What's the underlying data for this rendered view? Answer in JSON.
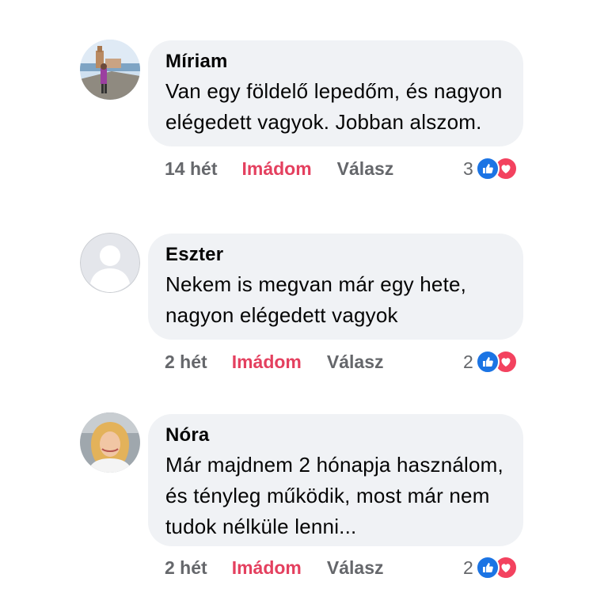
{
  "comments": [
    {
      "author": "Míriam",
      "lines": [
        "Van egy földelő lepedőm, és nagyon",
        "elégedett vagyok. Jobban alszom."
      ],
      "time": "14 hét",
      "love_label": "Imádom",
      "reply_label": "Válasz",
      "reaction_count": "3",
      "avatar": "photo-avatar-seaside"
    },
    {
      "author": "Eszter",
      "lines": [
        "Nekem is megvan már egy hete,",
        "nagyon elégedett vagyok"
      ],
      "time": "2 hét",
      "love_label": "Imádom",
      "reply_label": "Válasz",
      "reaction_count": "2",
      "avatar": "default-avatar"
    },
    {
      "author": "Nóra",
      "lines": [
        "Már majdnem 2 hónapja használom,",
        "és tényleg működik, most már nem",
        "tudok nélküle lenni..."
      ],
      "time": "2 hét",
      "love_label": "Imádom",
      "reply_label": "Válasz",
      "reaction_count": "2",
      "avatar": "photo-avatar-woman"
    }
  ],
  "colors": {
    "bubble": "#f0f2f5",
    "love": "#e4405f",
    "like_icon": "#1b74e4",
    "heart_icon": "#f3425f",
    "meta": "#65676b"
  },
  "icons": [
    "like-icon",
    "heart-icon"
  ]
}
